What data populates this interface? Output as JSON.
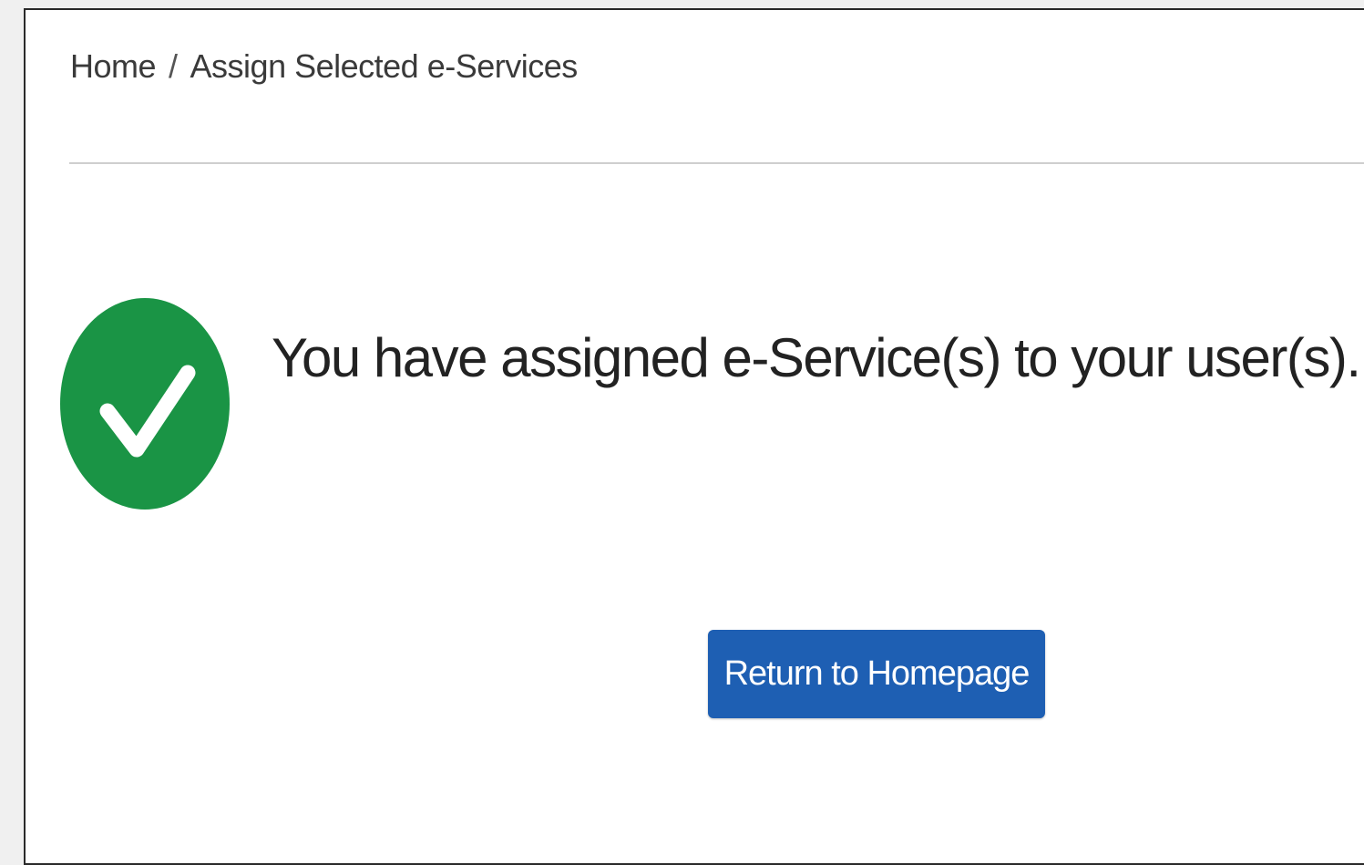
{
  "breadcrumb": {
    "home_label": "Home",
    "separator": "/",
    "current_label": "Assign Selected e-Services"
  },
  "status": {
    "icon": "check-circle-icon",
    "color": "#1a9445",
    "message": "You have assigned e-Service(s) to your user(s)."
  },
  "actions": {
    "return_label": "Return to Homepage",
    "color": "#1e5fb3"
  }
}
